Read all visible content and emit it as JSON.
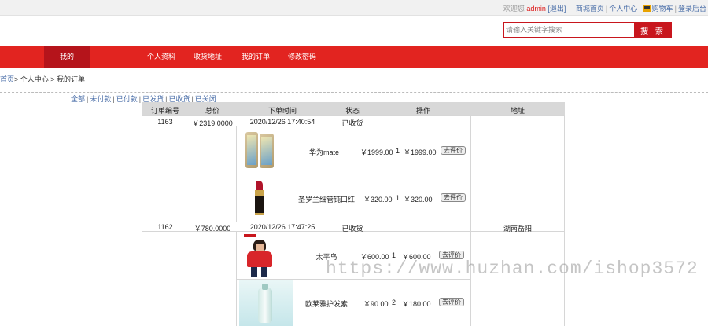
{
  "topbar": {
    "welcome": "欢迎您",
    "username": "admin",
    "logout": "[退出]",
    "links": [
      "商城首页",
      "个人中心",
      "购物车",
      "登录后台"
    ]
  },
  "search": {
    "placeholder": "请输入关键字搜索",
    "button": "搜 索"
  },
  "nav": {
    "active": "我的",
    "items": [
      "个人资料",
      "收货地址",
      "我的订单",
      "修改密码"
    ]
  },
  "breadcrumb": {
    "home": "首页",
    "rest": "> 个人中心 > 我的订单"
  },
  "filters": [
    "全部",
    "未付款",
    "已付款",
    "已发货",
    "已收货",
    "已关闭"
  ],
  "table": {
    "headers": [
      "订单编号",
      "总价",
      "下单时间",
      "状态",
      "操作",
      "地址"
    ],
    "comment_label": "去评价",
    "orders": [
      {
        "id": "1163",
        "total": "￥2319.0000",
        "time": "2020/12/26 17:40:54",
        "status": "已收货",
        "address": "",
        "items": [
          {
            "name": "华为mate",
            "price": "￥1999.00",
            "qty": "1",
            "subtotal": "￥1999.00",
            "image_icon": "phone-product-image"
          },
          {
            "name": "圣罗兰细管钝口红",
            "price": "￥320.00",
            "qty": "1",
            "subtotal": "￥320.00",
            "image_icon": "lipstick-product-image"
          }
        ]
      },
      {
        "id": "1162",
        "total": "￥780.0000",
        "time": "2020/12/26 17:47:25",
        "status": "已收货",
        "address": "湖南岳阳",
        "items": [
          {
            "name": "太平鸟",
            "price": "￥600.00",
            "qty": "1",
            "subtotal": "￥600.00",
            "image_icon": "clothing-product-image"
          },
          {
            "name": "欧莱雅护发素",
            "price": "￥90.00",
            "qty": "2",
            "subtotal": "￥180.00",
            "image_icon": "shampoo-product-image"
          }
        ]
      }
    ]
  },
  "watermark": "https://www.huzhan.com/ishop3572",
  "colors": {
    "brand_red": "#e22420",
    "nav_active": "#b5141b",
    "link_blue": "#4a6ea8"
  }
}
